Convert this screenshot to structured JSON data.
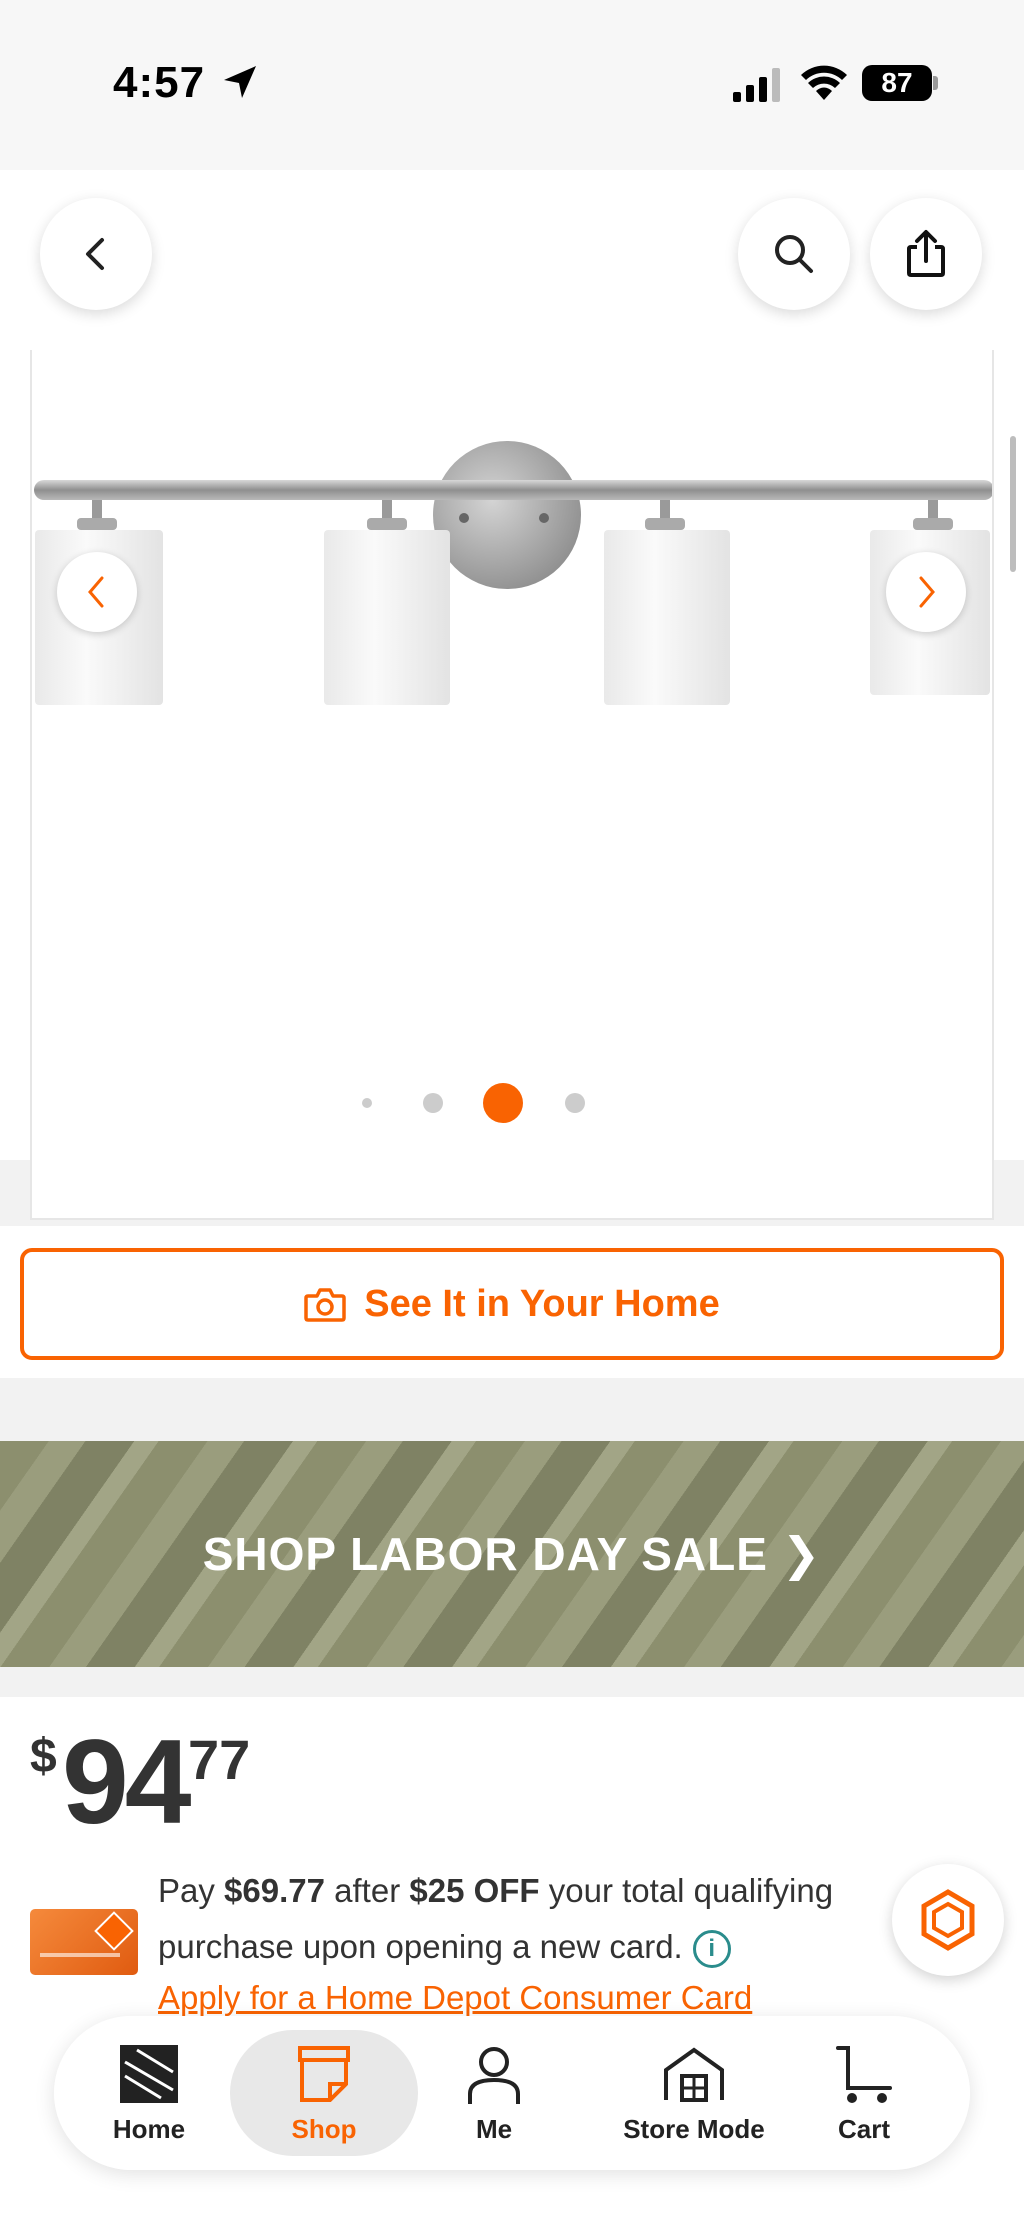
{
  "status_bar": {
    "time": "4:57",
    "battery": "87"
  },
  "header": {
    "back_icon": "chevron-left-icon",
    "search_icon": "search-icon",
    "share_icon": "share-icon"
  },
  "gallery": {
    "image": "vanity-light-fixture",
    "total_dots": 4,
    "active_dot": 3
  },
  "see_it": {
    "label": "See It in Your Home",
    "icon": "camera-icon"
  },
  "banner": {
    "text": "SHOP LABOR DAY SALE ❯"
  },
  "price": {
    "currency": "$",
    "dollars": "94",
    "cents": "77"
  },
  "promo": {
    "text_pay": "Pay ",
    "amount": "$69.77",
    "text_after": " after ",
    "discount": "$25 OFF",
    "text_rest": " your total qualifying purchase upon opening a new card.",
    "link": "Apply for a Home Depot Consumer Card"
  },
  "colors": {
    "brand_orange": "#f96302",
    "info_teal": "#2a8c8c"
  },
  "bottom_nav": {
    "items": [
      {
        "label": "Home",
        "icon": "home-depot-logo-icon"
      },
      {
        "label": "Shop",
        "icon": "shop-icon",
        "active": true
      },
      {
        "label": "Me",
        "icon": "person-icon"
      },
      {
        "label": "Store Mode",
        "icon": "store-icon"
      },
      {
        "label": "Cart",
        "icon": "cart-icon"
      }
    ]
  }
}
